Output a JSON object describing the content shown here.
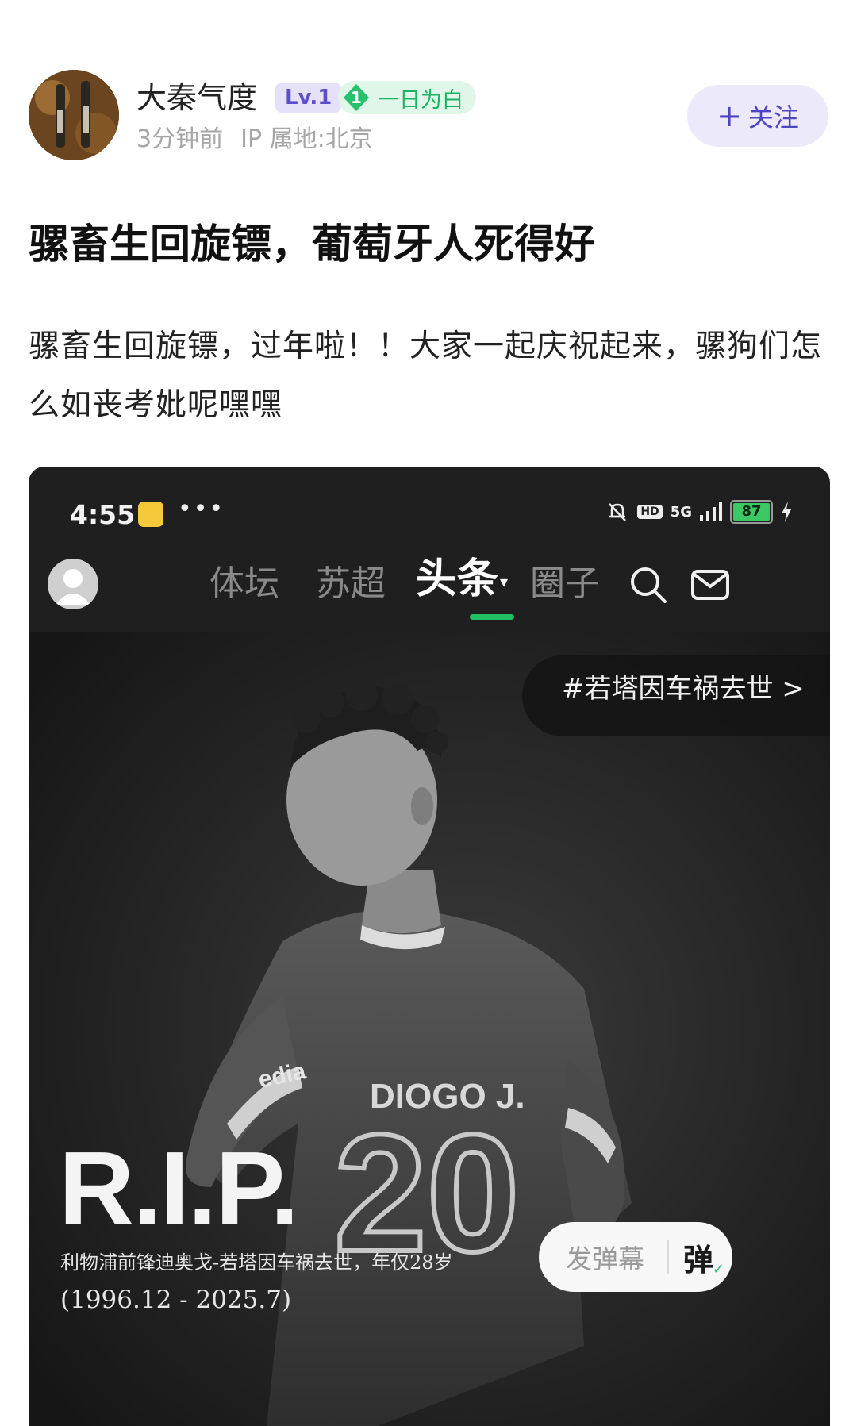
{
  "author": {
    "name": "大秦气度",
    "level": "Lv.1",
    "fan_badge_level": "1",
    "fan_badge_text": "一日为白",
    "time_ago": "3分钟前",
    "ip_location": "IP 属地:北京",
    "follow_label": "关注",
    "follow_plus": "+"
  },
  "post": {
    "title": "骡畜生回旋镖，葡萄牙人死得好",
    "body": "骡畜生回旋镖，过年啦！！大家一起庆祝起来，骡狗们怎么如丧考妣呢嘿嘿"
  },
  "embedded_screenshot": {
    "status_bar": {
      "time": "4:55",
      "dots": "•••",
      "hd": "HD",
      "network": "5G",
      "battery": "87"
    },
    "nav_tabs": [
      {
        "label": "体坛",
        "active": false
      },
      {
        "label": "苏超",
        "active": false
      },
      {
        "label": "头条",
        "active": true
      },
      {
        "label": "圈子",
        "active": false
      }
    ],
    "active_caret": "▾",
    "topic": "#若塔因车祸去世 >",
    "jersey_name": "DIOGO J.",
    "jersey_number": "20",
    "sponsor": "edia",
    "rip_text": "R.I.P.",
    "caption": "利物浦前锋迪奥戈-若塔因车祸去世，年仅28岁",
    "dates": "(1996.12 - 2025.7)",
    "danmaku_send": "发弹幕",
    "danmaku_toggle": "弹",
    "colors": {
      "accent_green": "#21c064",
      "follow_purple": "#4e45c0"
    }
  }
}
